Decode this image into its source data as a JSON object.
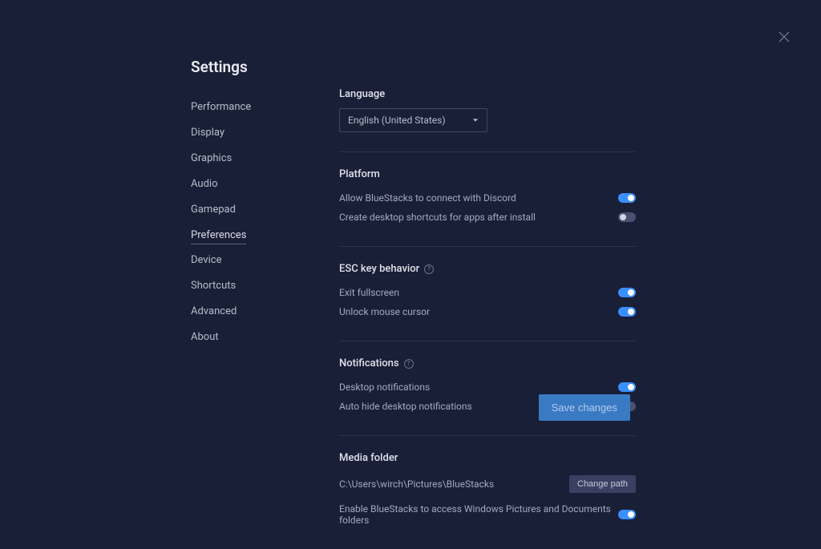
{
  "page": {
    "title": "Settings"
  },
  "sidebar": {
    "items": [
      {
        "label": "Performance",
        "active": false
      },
      {
        "label": "Display",
        "active": false
      },
      {
        "label": "Graphics",
        "active": false
      },
      {
        "label": "Audio",
        "active": false
      },
      {
        "label": "Gamepad",
        "active": false
      },
      {
        "label": "Preferences",
        "active": true
      },
      {
        "label": "Device",
        "active": false
      },
      {
        "label": "Shortcuts",
        "active": false
      },
      {
        "label": "Advanced",
        "active": false
      },
      {
        "label": "About",
        "active": false
      }
    ]
  },
  "sections": {
    "language": {
      "title": "Language",
      "selected": "English (United States)"
    },
    "platform": {
      "title": "Platform",
      "rows": [
        {
          "label": "Allow BlueStacks to connect with Discord",
          "on": true
        },
        {
          "label": "Create desktop shortcuts for apps after install",
          "on": false
        }
      ]
    },
    "esc": {
      "title": "ESC key behavior",
      "rows": [
        {
          "label": "Exit fullscreen",
          "on": true
        },
        {
          "label": "Unlock mouse cursor",
          "on": true
        }
      ]
    },
    "notifications": {
      "title": "Notifications",
      "rows": [
        {
          "label": "Desktop notifications",
          "on": true
        },
        {
          "label": "Auto hide desktop notifications",
          "on": false
        }
      ]
    },
    "media": {
      "title": "Media folder",
      "path": "C:\\Users\\wirch\\Pictures\\BlueStacks",
      "change_label": "Change path",
      "access_label": "Enable BlueStacks to access Windows Pictures and Documents folders",
      "access_on": true
    }
  },
  "footer": {
    "save_label": "Save changes"
  }
}
